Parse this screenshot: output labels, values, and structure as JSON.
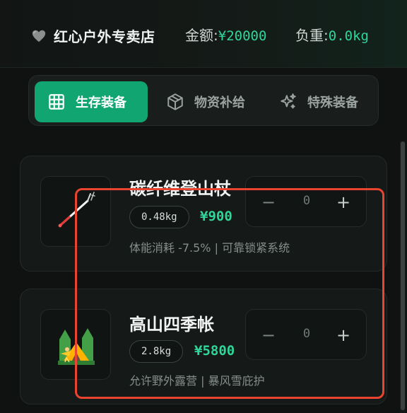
{
  "header": {
    "store_name": "红心户外专卖店",
    "money_label": "金额: ",
    "money_value": "¥20000",
    "weight_label": "负重: ",
    "weight_value": "0.0kg"
  },
  "tabs": [
    {
      "label": "生存装备",
      "icon": "grid-icon",
      "active": true
    },
    {
      "label": "物资补给",
      "icon": "box-icon",
      "active": false
    },
    {
      "label": "特殊装备",
      "icon": "sparkle-icon",
      "active": false
    }
  ],
  "items": [
    {
      "name": "碳纤维登山杖",
      "weight": "0.48kg",
      "price": "¥900",
      "desc": "体能消耗 -7.5% | 可靠锁紧系统",
      "qty": "0",
      "minus": "−",
      "plus": "+",
      "icon": "trekking-pole-icon"
    },
    {
      "name": "高山四季帐",
      "weight": "2.8kg",
      "price": "¥5800",
      "desc": "允许野外露营 | 暴风雪庇护",
      "qty": "0",
      "minus": "−",
      "plus": "+",
      "icon": "tent-icon"
    }
  ],
  "colors": {
    "accent": "#11a572",
    "price": "#2fd69a",
    "highlight": "#e8442f"
  }
}
